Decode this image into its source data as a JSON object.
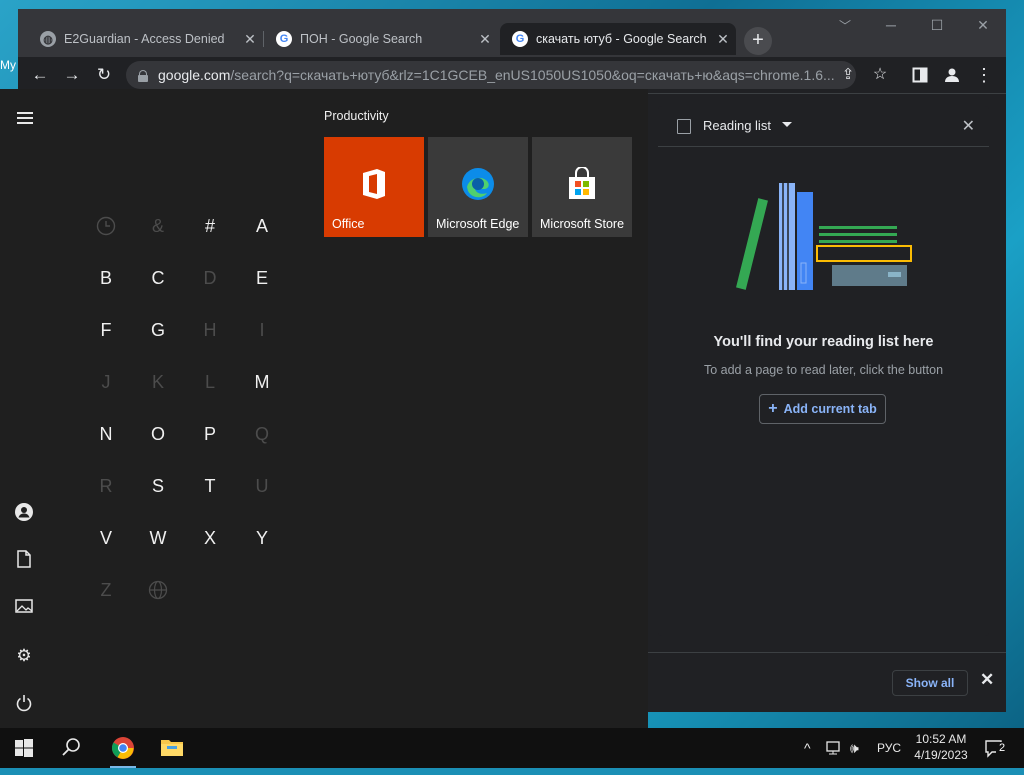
{
  "desktop": {
    "peek_label": "My"
  },
  "browser": {
    "tabs": [
      {
        "title": "E2Guardian - Access Denied",
        "close": "✕"
      },
      {
        "title": "ПОН - Google Search",
        "close": "✕"
      },
      {
        "title": "скачать ютуб - Google Search",
        "close": "✕"
      }
    ],
    "new_tab": "+",
    "window_controls": {
      "minimize": "─",
      "maximize": "☐",
      "close": "✕"
    },
    "toolbar": {
      "back": "←",
      "forward": "→",
      "reload": "↻"
    },
    "address": {
      "host": "google.com",
      "path": "/search?q=скачать+ютуб&rlz=1C1GCEB_enUS1050US1050&oq=скачать+ю&aqs=chrome.1.6..."
    }
  },
  "reading_list": {
    "title": "Reading list",
    "close": "✕",
    "empty_heading": "You'll find your reading list here",
    "empty_desc": "To add a page to read later, click the button",
    "add_button": "Add current tab",
    "add_plus": "+"
  },
  "download_bar": {
    "show_all": "Show all",
    "close": "✕"
  },
  "start_menu": {
    "group_title": "Productivity",
    "tiles": [
      {
        "label": "Office",
        "color": "#d83b01"
      },
      {
        "label": "Microsoft Edge",
        "color": "#3a3a3a"
      },
      {
        "label": "Microsoft Store",
        "color": "#3a3a3a"
      }
    ],
    "letters": [
      {
        "ch": "",
        "enabled": false,
        "icon": "clock-icon"
      },
      {
        "ch": "&",
        "enabled": false
      },
      {
        "ch": "#",
        "enabled": true
      },
      {
        "ch": "A",
        "enabled": true
      },
      {
        "ch": "B",
        "enabled": true
      },
      {
        "ch": "C",
        "enabled": true
      },
      {
        "ch": "D",
        "enabled": false
      },
      {
        "ch": "E",
        "enabled": true
      },
      {
        "ch": "F",
        "enabled": true
      },
      {
        "ch": "G",
        "enabled": true
      },
      {
        "ch": "H",
        "enabled": false
      },
      {
        "ch": "I",
        "enabled": false
      },
      {
        "ch": "J",
        "enabled": false
      },
      {
        "ch": "K",
        "enabled": false
      },
      {
        "ch": "L",
        "enabled": false
      },
      {
        "ch": "M",
        "enabled": true
      },
      {
        "ch": "N",
        "enabled": true
      },
      {
        "ch": "O",
        "enabled": true
      },
      {
        "ch": "P",
        "enabled": true
      },
      {
        "ch": "Q",
        "enabled": false
      },
      {
        "ch": "R",
        "enabled": false
      },
      {
        "ch": "S",
        "enabled": true
      },
      {
        "ch": "T",
        "enabled": true
      },
      {
        "ch": "U",
        "enabled": false
      },
      {
        "ch": "V",
        "enabled": true
      },
      {
        "ch": "W",
        "enabled": true
      },
      {
        "ch": "X",
        "enabled": true
      },
      {
        "ch": "Y",
        "enabled": true
      },
      {
        "ch": "Z",
        "enabled": false
      },
      {
        "ch": "",
        "enabled": false,
        "icon": "globe-icon"
      }
    ]
  },
  "taskbar": {
    "language": "РУС",
    "time": "10:52 AM",
    "date": "4/19/2023",
    "notification_count": "2",
    "tray_chevron": "^"
  }
}
